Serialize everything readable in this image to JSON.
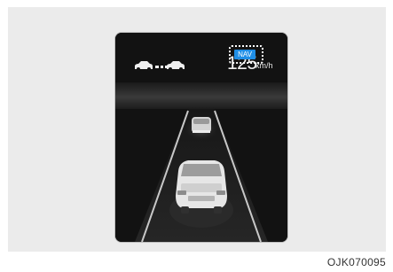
{
  "cluster": {
    "speed_value": "125",
    "speed_unit": "km/h",
    "nav_label": "NAV",
    "distance_icon": "vehicle-distance-icon",
    "colors": {
      "nav_badge": "#1f8ee6",
      "background": "#141414",
      "road_lines": "#c8c8c8"
    }
  },
  "caption": {
    "code": "OJK070095"
  }
}
